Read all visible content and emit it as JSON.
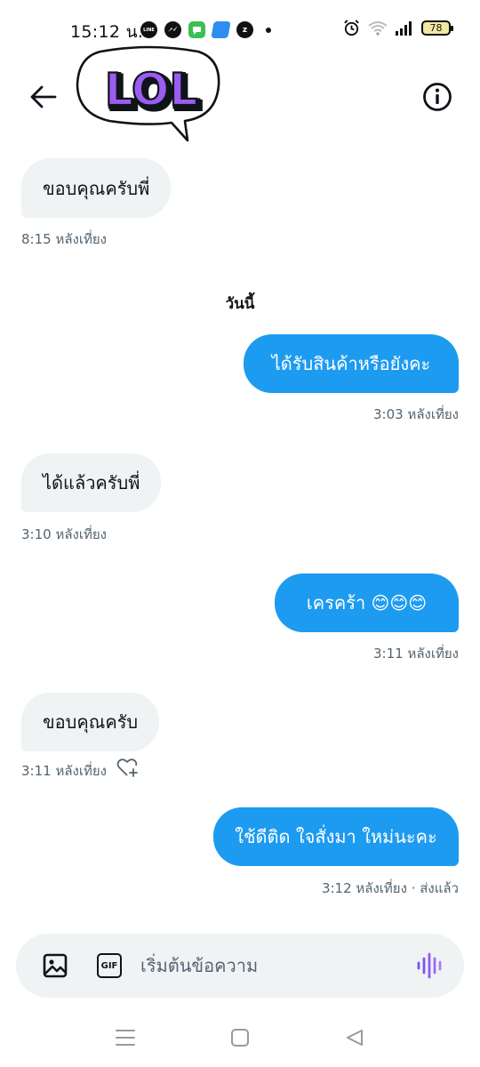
{
  "status_bar": {
    "time": "15:12 น.",
    "battery": "78",
    "app_icons": [
      "line-icon",
      "messenger-icon",
      "messages-icon",
      "blue-app-icon",
      "z-app-icon",
      "more-dot-icon"
    ],
    "system_icons": [
      "alarm-icon",
      "wifi-icon",
      "signal-icon",
      "battery-icon"
    ]
  },
  "header": {
    "logo_text": "LOL",
    "back_icon": "arrow-left-icon",
    "info_icon": "info-icon"
  },
  "colors": {
    "outgoing_bubble": "#1d9bf0",
    "incoming_bubble": "#eff3f4",
    "meta_text": "#536471",
    "voice_accent": "#8b5cf6"
  },
  "conversation": {
    "earlier": [
      {
        "direction": "incoming",
        "text": "ขอบคุณครับพี่",
        "time": "8:15 หลังเที่ยง"
      }
    ],
    "day_label": "วันนี้",
    "today": [
      {
        "direction": "outgoing",
        "text": "ได้รับสินค้าหรือยังคะ",
        "time": "3:03 หลังเที่ยง"
      },
      {
        "direction": "incoming",
        "text": "ได้แล้วครับพี่",
        "time": "3:10 หลังเที่ยง"
      },
      {
        "direction": "outgoing",
        "text": "เครคร้า 😊😊😊",
        "time": "3:11 หลังเที่ยง"
      },
      {
        "direction": "incoming",
        "text": "ขอบคุณครับ",
        "time": "3:11 หลังเที่ยง",
        "has_react_icon": true
      },
      {
        "direction": "outgoing",
        "text": "ใช้ดีติด ใจสั่งมา ใหม่นะคะ",
        "time": "3:12 หลังเที่ยง · ส่งแล้ว"
      }
    ]
  },
  "composer": {
    "placeholder": "เริ่มต้นข้อความ",
    "value": "",
    "gif_label": "GIF",
    "image_icon": "image-icon",
    "voice_icon": "voice-wave-icon"
  },
  "nav_bar": {
    "icons": [
      "menu-icon",
      "home-icon",
      "back-triangle-icon"
    ]
  }
}
